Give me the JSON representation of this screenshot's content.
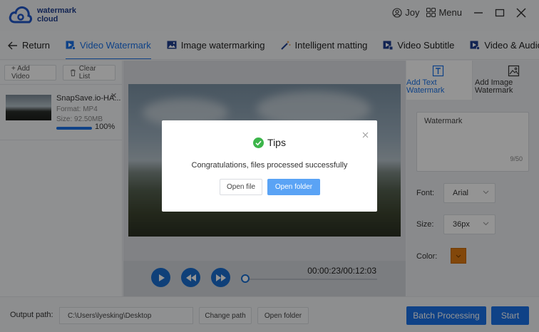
{
  "app": {
    "name_line1": "watermark",
    "name_line2": "cloud",
    "brand_color": "#1a73e8"
  },
  "titlebar": {
    "user": "Joy",
    "menu": "Menu"
  },
  "nav": [
    {
      "label": "Return",
      "icon": "arrow-left-icon"
    },
    {
      "label": "Video Watermark",
      "icon": "video-watermark-icon",
      "active": true
    },
    {
      "label": "Image watermarking",
      "icon": "image-icon"
    },
    {
      "label": "Intelligent matting",
      "icon": "magic-wand-icon"
    },
    {
      "label": "Video Subtitle",
      "icon": "subtitle-icon"
    },
    {
      "label": "Video & Audio Sepa",
      "icon": "audio-separate-icon"
    }
  ],
  "left_panel": {
    "add_video": "+ Add Video",
    "clear_list": "Clear List",
    "file": {
      "name": "SnapSave.io-HA...",
      "format": "Format:  MP4",
      "size": "Size:  92.50MB",
      "progress": "100%",
      "progress_value": 100
    }
  },
  "player": {
    "timecode": "00:00:23/00:12:03"
  },
  "right_panel": {
    "tab_text": "Add Text Watermark",
    "tab_image": "Add Image Watermark",
    "watermark_text": "Watermark",
    "counter": "9/50",
    "font_label": "Font:",
    "font_value": "Arial",
    "size_label": "Size:",
    "size_value": "36px",
    "color_label": "Color:",
    "color_value": "#e07b12"
  },
  "footer": {
    "output_label": "Output path:",
    "output_path": "C:\\Users\\lyesking\\Desktop",
    "change_path": "Change path",
    "open_folder": "Open folder",
    "batch": "Batch Processing",
    "start": "Start"
  },
  "dialog": {
    "title": "Tips",
    "message": "Congratulations, files processed successfully",
    "open_file": "Open file",
    "open_folder": "Open folder"
  }
}
